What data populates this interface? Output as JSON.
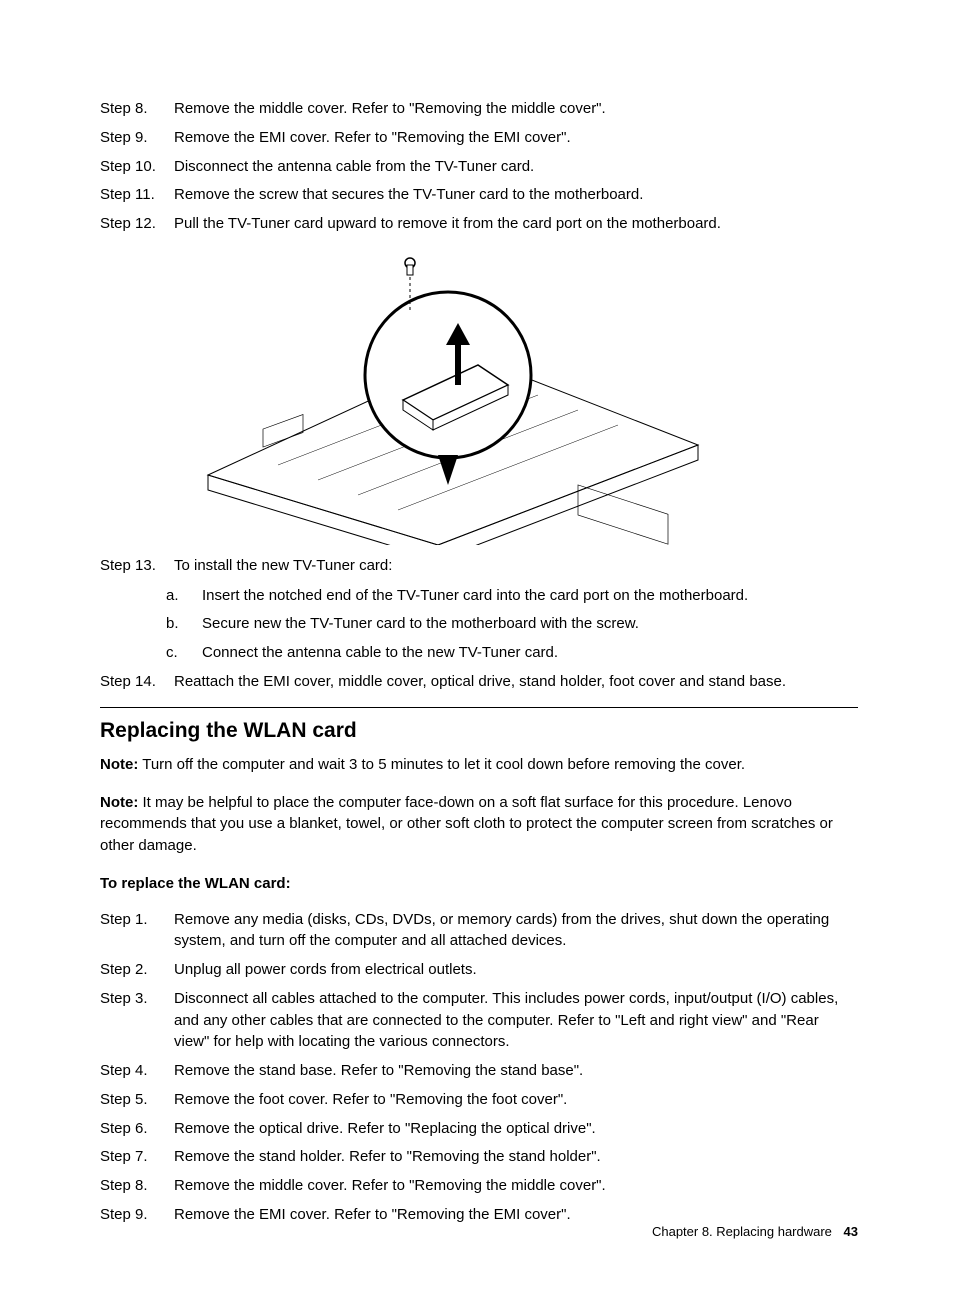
{
  "steps_a": [
    {
      "label": "Step 8.",
      "text": "Remove the middle cover. Refer to \"Removing the middle cover\"."
    },
    {
      "label": "Step 9.",
      "text": "Remove the EMI cover. Refer to \"Removing the EMI cover\"."
    },
    {
      "label": "Step 10.",
      "text": "Disconnect the antenna cable from the TV-Tuner card."
    },
    {
      "label": "Step 11.",
      "text": "Remove the screw that secures the TV-Tuner card to the motherboard."
    },
    {
      "label": "Step 12.",
      "text": "Pull the TV-Tuner card upward to remove it from the card port on the motherboard."
    }
  ],
  "step13": {
    "label": "Step 13.",
    "text": "To install the new TV-Tuner card:"
  },
  "step13_sub": [
    {
      "label": "a.",
      "text": "Insert the notched end of the TV-Tuner card into the card port on the motherboard."
    },
    {
      "label": "b.",
      "text": "Secure new the TV-Tuner card to the motherboard with the screw."
    },
    {
      "label": "c.",
      "text": "Connect the antenna cable to the new TV-Tuner card."
    }
  ],
  "step14": {
    "label": "Step 14.",
    "text": "Reattach the EMI cover, middle cover, optical drive, stand holder, foot cover and stand base."
  },
  "section": {
    "title": "Replacing the WLAN card",
    "note1_label": "Note:",
    "note1_text": " Turn off the computer and wait 3 to 5 minutes to let it cool down before removing the cover.",
    "note2_label": "Note:",
    "note2_text": " It may be helpful to place the computer face-down on a soft flat surface for this procedure. Lenovo recommends that you use a blanket, towel, or other soft cloth to protect the computer screen from scratches or other damage.",
    "subheading": "To replace the WLAN card:"
  },
  "steps_b": [
    {
      "label": "Step 1.",
      "text": "Remove any media (disks, CDs, DVDs, or memory cards) from the drives, shut down the operating system, and turn off the computer and all attached devices."
    },
    {
      "label": "Step 2.",
      "text": "Unplug all power cords from electrical outlets."
    },
    {
      "label": "Step 3.",
      "text": "Disconnect all cables attached to the computer. This includes power cords, input/output (I/O) cables, and any other cables that are connected to the computer. Refer to \"Left and right view\" and \"Rear view\" for help with locating the various connectors."
    },
    {
      "label": "Step 4.",
      "text": "Remove the stand base. Refer to \"Removing the stand base\"."
    },
    {
      "label": "Step 5.",
      "text": "Remove the foot cover. Refer to \"Removing the foot cover\"."
    },
    {
      "label": "Step 6.",
      "text": "Remove the optical drive. Refer to \"Replacing the optical drive\"."
    },
    {
      "label": "Step 7.",
      "text": "Remove the stand holder. Refer to \"Removing the stand holder\"."
    },
    {
      "label": "Step 8.",
      "text": "Remove the middle cover. Refer to \"Removing the middle cover\"."
    },
    {
      "label": "Step 9.",
      "text": "Remove the EMI cover. Refer to \"Removing the EMI cover\"."
    }
  ],
  "footer": {
    "chapter": "Chapter 8. Replacing hardware",
    "page": "43"
  }
}
